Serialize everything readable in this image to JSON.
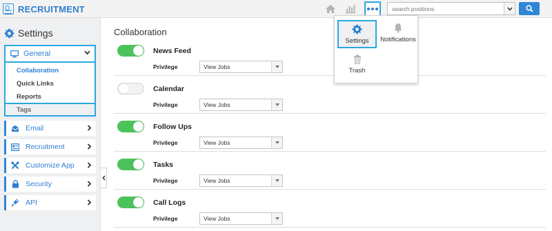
{
  "app": {
    "brand": "RECRUITMENT"
  },
  "topbar": {
    "home_icon": "home-icon",
    "chart_icon": "chart-icon",
    "more_icon": "more-dots-icon",
    "search_placeholder": "search positions"
  },
  "menu": {
    "items": [
      {
        "label": "Settings",
        "icon": "gear-icon",
        "selected": true
      },
      {
        "label": "Notifications",
        "icon": "bell-icon",
        "selected": false
      },
      {
        "label": "Trash",
        "icon": "trash-icon",
        "selected": false
      }
    ]
  },
  "sidebar": {
    "title": "Settings",
    "general": {
      "label": "General",
      "subitems": [
        {
          "label": "Collaboration",
          "active": true
        },
        {
          "label": "Quick Links",
          "active": false
        },
        {
          "label": "Reports",
          "active": false
        },
        {
          "label": "Tags",
          "active": false
        }
      ]
    },
    "items": [
      {
        "label": "Email",
        "icon": "email-icon"
      },
      {
        "label": "Recruitment",
        "icon": "recruitment-icon"
      },
      {
        "label": "Customize App",
        "icon": "tools-icon"
      },
      {
        "label": "Security",
        "icon": "lock-icon"
      },
      {
        "label": "API",
        "icon": "plug-icon"
      }
    ]
  },
  "main": {
    "title": "Collaboration",
    "privilege_label": "Privilege",
    "features": [
      {
        "name": "News Feed",
        "enabled": true,
        "privilege": "View Jobs"
      },
      {
        "name": "Calendar",
        "enabled": false,
        "privilege": "View Jobs"
      },
      {
        "name": "Follow Ups",
        "enabled": true,
        "privilege": "View Jobs"
      },
      {
        "name": "Tasks",
        "enabled": true,
        "privilege": "View Jobs"
      },
      {
        "name": "Call Logs",
        "enabled": true,
        "privilege": "View Jobs"
      }
    ]
  },
  "colors": {
    "accent": "#2f7fd0",
    "highlight": "#29a8e0",
    "toggle_on": "#4cc35a"
  }
}
